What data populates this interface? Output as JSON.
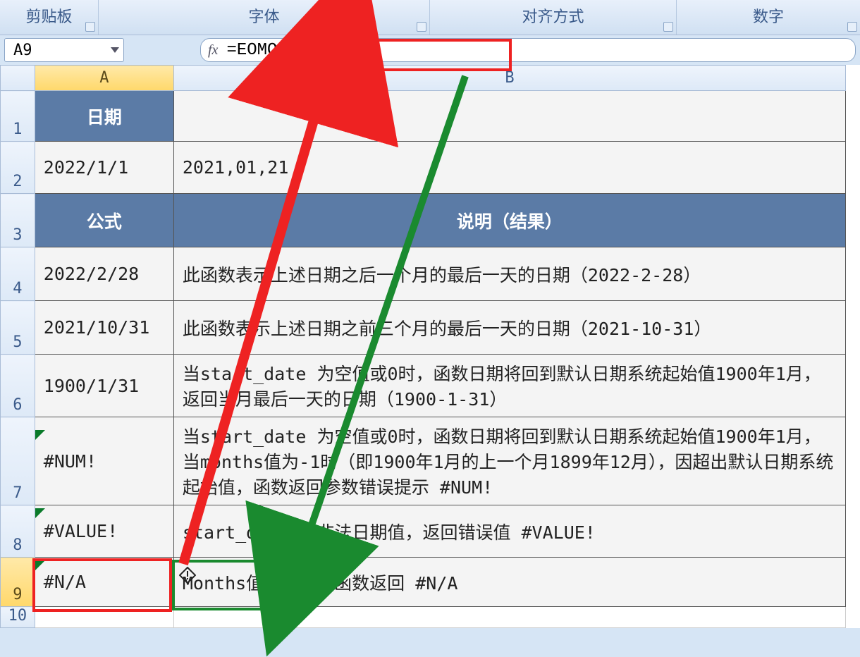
{
  "ribbon": {
    "clipboard": "剪贴板",
    "font": "字体",
    "alignment": "对齐方式",
    "number": "数字"
  },
  "formula_bar": {
    "name_box": "A9",
    "fx_label": "fx",
    "formula": "=EOMONTH(A2,)"
  },
  "columns": {
    "A": "A",
    "B": "B"
  },
  "row_labels": [
    "1",
    "2",
    "3",
    "4",
    "5",
    "6",
    "7",
    "8",
    "9",
    "10"
  ],
  "rows": [
    {
      "a": "日期",
      "b": "",
      "header": true
    },
    {
      "a": "2022/1/1",
      "b": "2021,01,21"
    },
    {
      "a": "公式",
      "b": "说明（结果）",
      "header": true
    },
    {
      "a": "2022/2/28",
      "b": "此函数表示上述日期之后一个月的最后一天的日期（2022-2-28）"
    },
    {
      "a": "2021/10/31",
      "b": "此函数表示上述日期之前三个月的最后一天的日期（2021-10-31）"
    },
    {
      "a": "1900/1/31",
      "b": "当start_date 为空值或0时，函数日期将回到默认日期系统起始值1900年1月，返回当月最后一天的日期（1900-1-31）"
    },
    {
      "a": "#NUM!",
      "b": "当start_date 为空值或0时，函数日期将回到默认日期系统起始值1900年1月，当months值为-1时（即1900年1月的上一个月1899年12月），因超出默认日期系统起始值，函数返回参数错误提示 #NUM!"
    },
    {
      "a": "#VALUE!",
      "b": "start_date 为非法日期值，返回错误值 #VALUE!"
    },
    {
      "a": "#N/A",
      "b": "Months值为空值，函数返回 #N/A"
    }
  ]
}
